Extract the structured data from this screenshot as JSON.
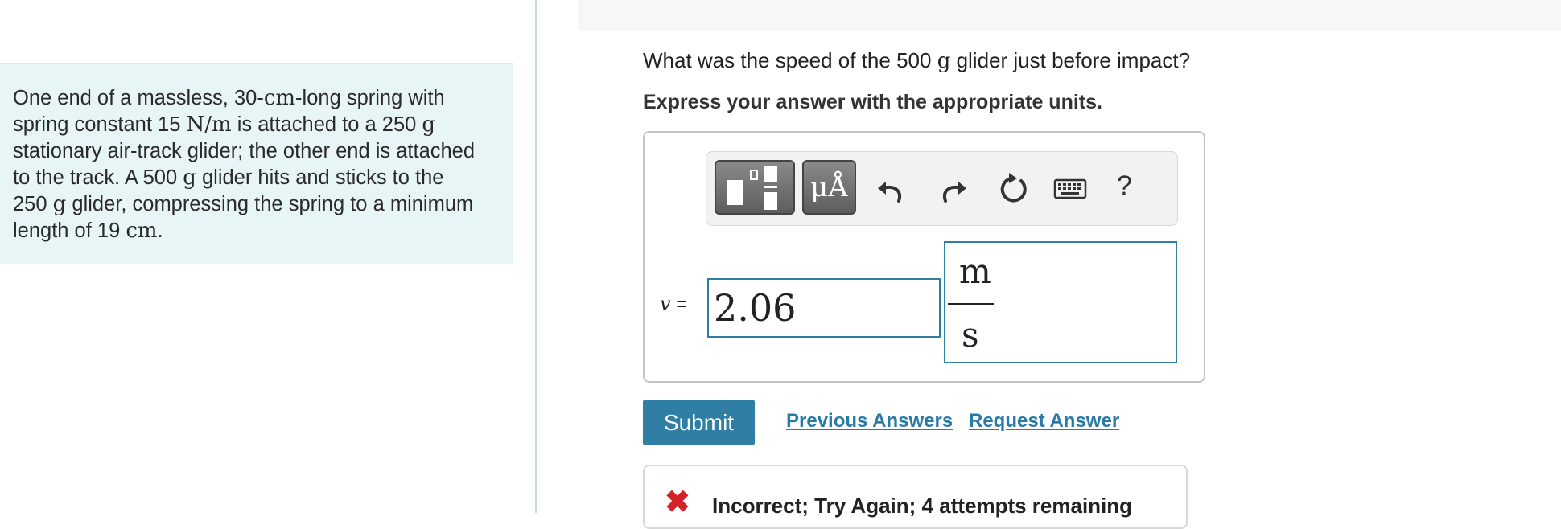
{
  "problem": {
    "line1a": "One end of a massless, 30-",
    "line1b": "cm",
    "line1c": "-long spring with",
    "line2a": "spring constant 15 ",
    "line2b": "N/m",
    "line2c": " is attached to a 250 ",
    "line2d": "g",
    "line3": "stationary air-track glider; the other end is attached",
    "line4a": "to the track. A 500 ",
    "line4b": "g",
    "line4c": " glider hits and sticks to the",
    "line5a": "250 ",
    "line5b": "g",
    "line5c": " glider, compressing the spring to a minimum",
    "line6a": "length of 19 ",
    "line6b": "cm",
    "line6c": "."
  },
  "question": {
    "part1": "What was the speed of the 500 ",
    "unit": "g",
    "part2": " glider just before impact?",
    "instruction": "Express your answer with the appropriate units."
  },
  "toolbar": {
    "units_label": "μÅ",
    "help_label": "?",
    "icons": [
      "templates-icon",
      "units-icon",
      "undo-icon",
      "redo-icon",
      "reset-icon",
      "keyboard-icon",
      "help-icon"
    ]
  },
  "answer": {
    "variable": "v",
    "equals": " =",
    "value": "2.06",
    "unit_numerator": "m",
    "unit_denominator": "s"
  },
  "actions": {
    "submit_label": "Submit",
    "previous_answers_label": "Previous Answers",
    "request_answer_label": "Request Answer"
  },
  "feedback": {
    "icon": "✖",
    "message": "Incorrect; Try Again; 4 attempts remaining"
  },
  "colors": {
    "problem_bg": "#e8f5f7",
    "accent": "#2f7ea3",
    "link": "#2a7aa6",
    "error": "#d2232a"
  }
}
